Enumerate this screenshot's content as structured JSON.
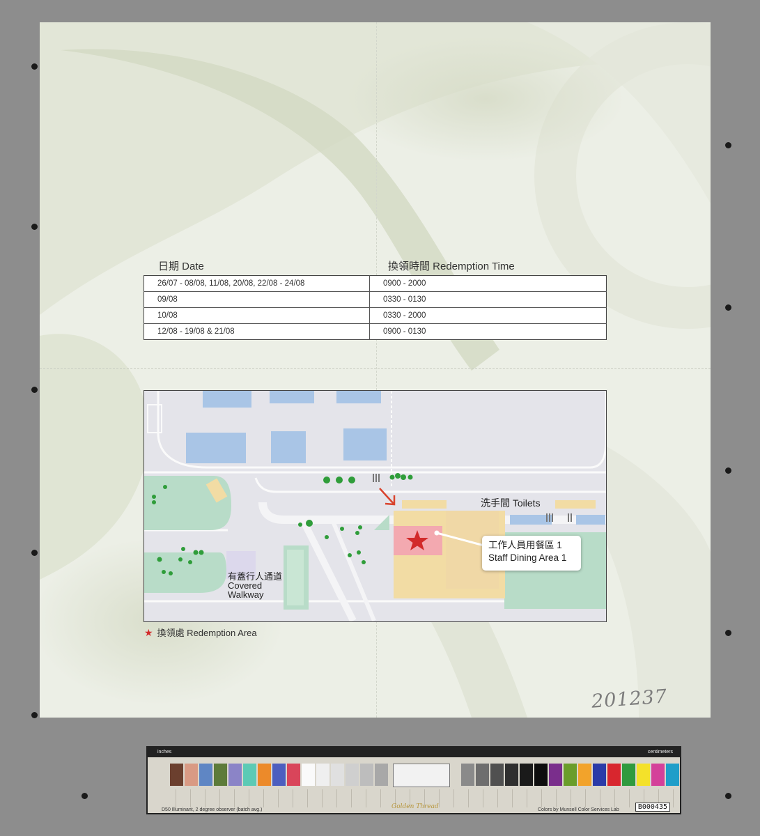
{
  "schedule": {
    "header_date": "日期 Date",
    "header_time": "換領時間 Redemption Time",
    "rows": [
      {
        "date": "26/07 - 08/08, 11/08, 20/08, 22/08 - 24/08",
        "time": "0900 - 2000"
      },
      {
        "date": "09/08",
        "time": "0330 - 0130"
      },
      {
        "date": "10/08",
        "time": "0330 - 2000"
      },
      {
        "date": "12/08 - 19/08 & 21/08",
        "time": "0900 - 0130"
      }
    ]
  },
  "map": {
    "toilets_label": "洗手間 Toilets",
    "dining_label_zh": "工作人員用餐區 1",
    "dining_label_en": "Staff Dining Area 1",
    "walkway_zh": "有蓋行人通道",
    "walkway_en1": "Covered",
    "walkway_en2": "Walkway",
    "colors": {
      "building": "#a9c5e6",
      "green": "#b8dcc8",
      "yellow": "#f2dca4",
      "redemption": "#f3a9b0",
      "star": "#d22a2a"
    }
  },
  "legend": {
    "label": "換領處 Redemption Area",
    "icon": "red-star-icon"
  },
  "handwritten_number": "201237",
  "color_target": {
    "left_scale": "inches",
    "right_scale": "centimeters",
    "footer": "D50 Illuminant, 2 degree observer (batch avg.)",
    "credit": "Colors by Munsell Color Services Lab",
    "brand": "Golden Thread",
    "code": "B000435"
  }
}
